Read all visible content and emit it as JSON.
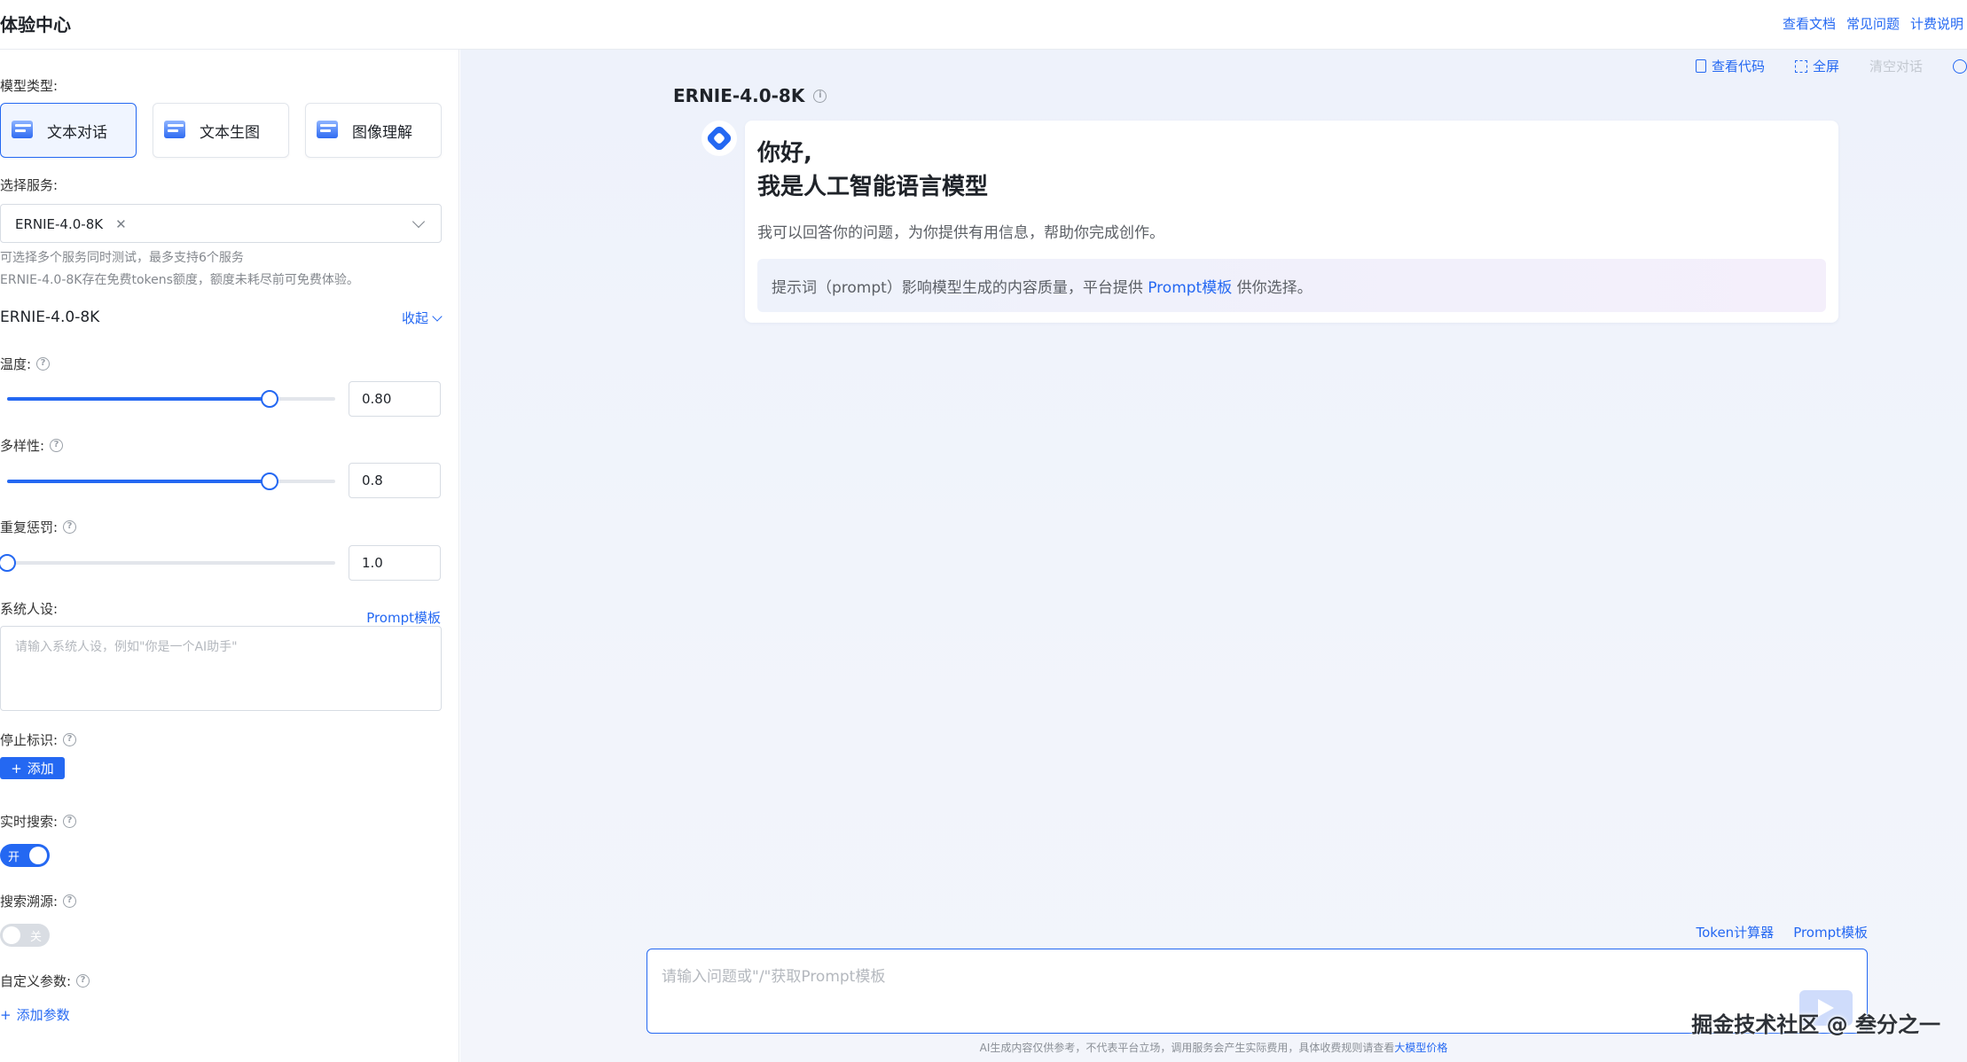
{
  "header": {
    "title": "体验中心",
    "links": [
      "查看文档",
      "常见问题",
      "计费说明"
    ]
  },
  "left": {
    "model_type_label": "模型类型:",
    "model_types": [
      "文本对话",
      "文本生图",
      "图像理解"
    ],
    "service_label": "选择服务:",
    "selected_service": "ERNIE-4.0-8K",
    "hint1": "可选择多个服务同时测试，最多支持6个服务",
    "hint2": "ERNIE-4.0-8K存在免费tokens额度，额度未耗尽前可免费体验。",
    "section_title": "ERNIE-4.0-8K",
    "collapse": "收起",
    "temperature_label": "温度:",
    "temperature": "0.80",
    "temperature_fraction": 0.8,
    "diversity_label": "多样性:",
    "diversity": "0.8",
    "diversity_fraction": 0.8,
    "penalty_label": "重复惩罚:",
    "penalty": "1.0",
    "penalty_fraction": 0.0,
    "system_label": "系统人设:",
    "prompt_template": "Prompt模板",
    "system_placeholder": "请输入系统人设，例如\"你是一个AI助手\"",
    "stop_label": "停止标识:",
    "add": "添加",
    "realtime_label": "实时搜索:",
    "realtime_state": "开",
    "trace_label": "搜索溯源:",
    "trace_state": "关",
    "custom_label": "自定义参数:",
    "add_param": "添加参数"
  },
  "main": {
    "tools": [
      "查看代码",
      "全屏",
      "清空对话"
    ],
    "model_name": "ERNIE-4.0-8K",
    "greeting1": "你好,",
    "greeting2": "我是人工智能语言模型",
    "intro": "我可以回答你的问题，为你提供有用信息，帮助你完成创作。",
    "tip_prefix": "提示词（prompt）影响模型生成的内容质量，平台提供 ",
    "tip_link": "Prompt模板",
    "tip_suffix": " 供你选择。",
    "bottom_links": [
      "Token计算器",
      "Prompt模板"
    ],
    "input_placeholder": "请输入问题或\"/\"获取Prompt模板",
    "footer_text": "AI生成内容仅供参考，不代表平台立场，调用服务会产生实际费用，具体收费规则请查看",
    "footer_link": "大模型价格",
    "watermark": "掘金技术社区 @ 叁分之一"
  },
  "colors": {
    "accent": "#2468f2",
    "border": "#d7dce3"
  }
}
